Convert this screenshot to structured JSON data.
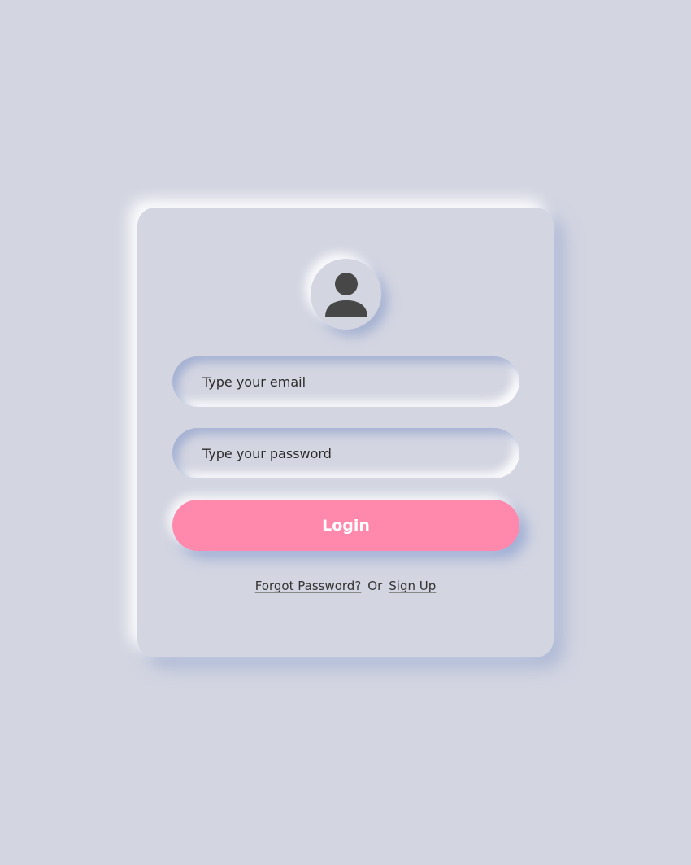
{
  "theme": {
    "background": "#d3d5e1",
    "accent": "#ff88ad",
    "text": "#333333",
    "icon_color": "#474747"
  },
  "avatar": {
    "icon": "user-icon"
  },
  "form": {
    "email_placeholder": "Type your email",
    "email_value": "",
    "password_placeholder": "Type your password",
    "password_value": "",
    "login_label": "Login"
  },
  "links": {
    "forgot_password": "Forgot Password?",
    "or": "Or",
    "sign_up": "Sign Up"
  }
}
